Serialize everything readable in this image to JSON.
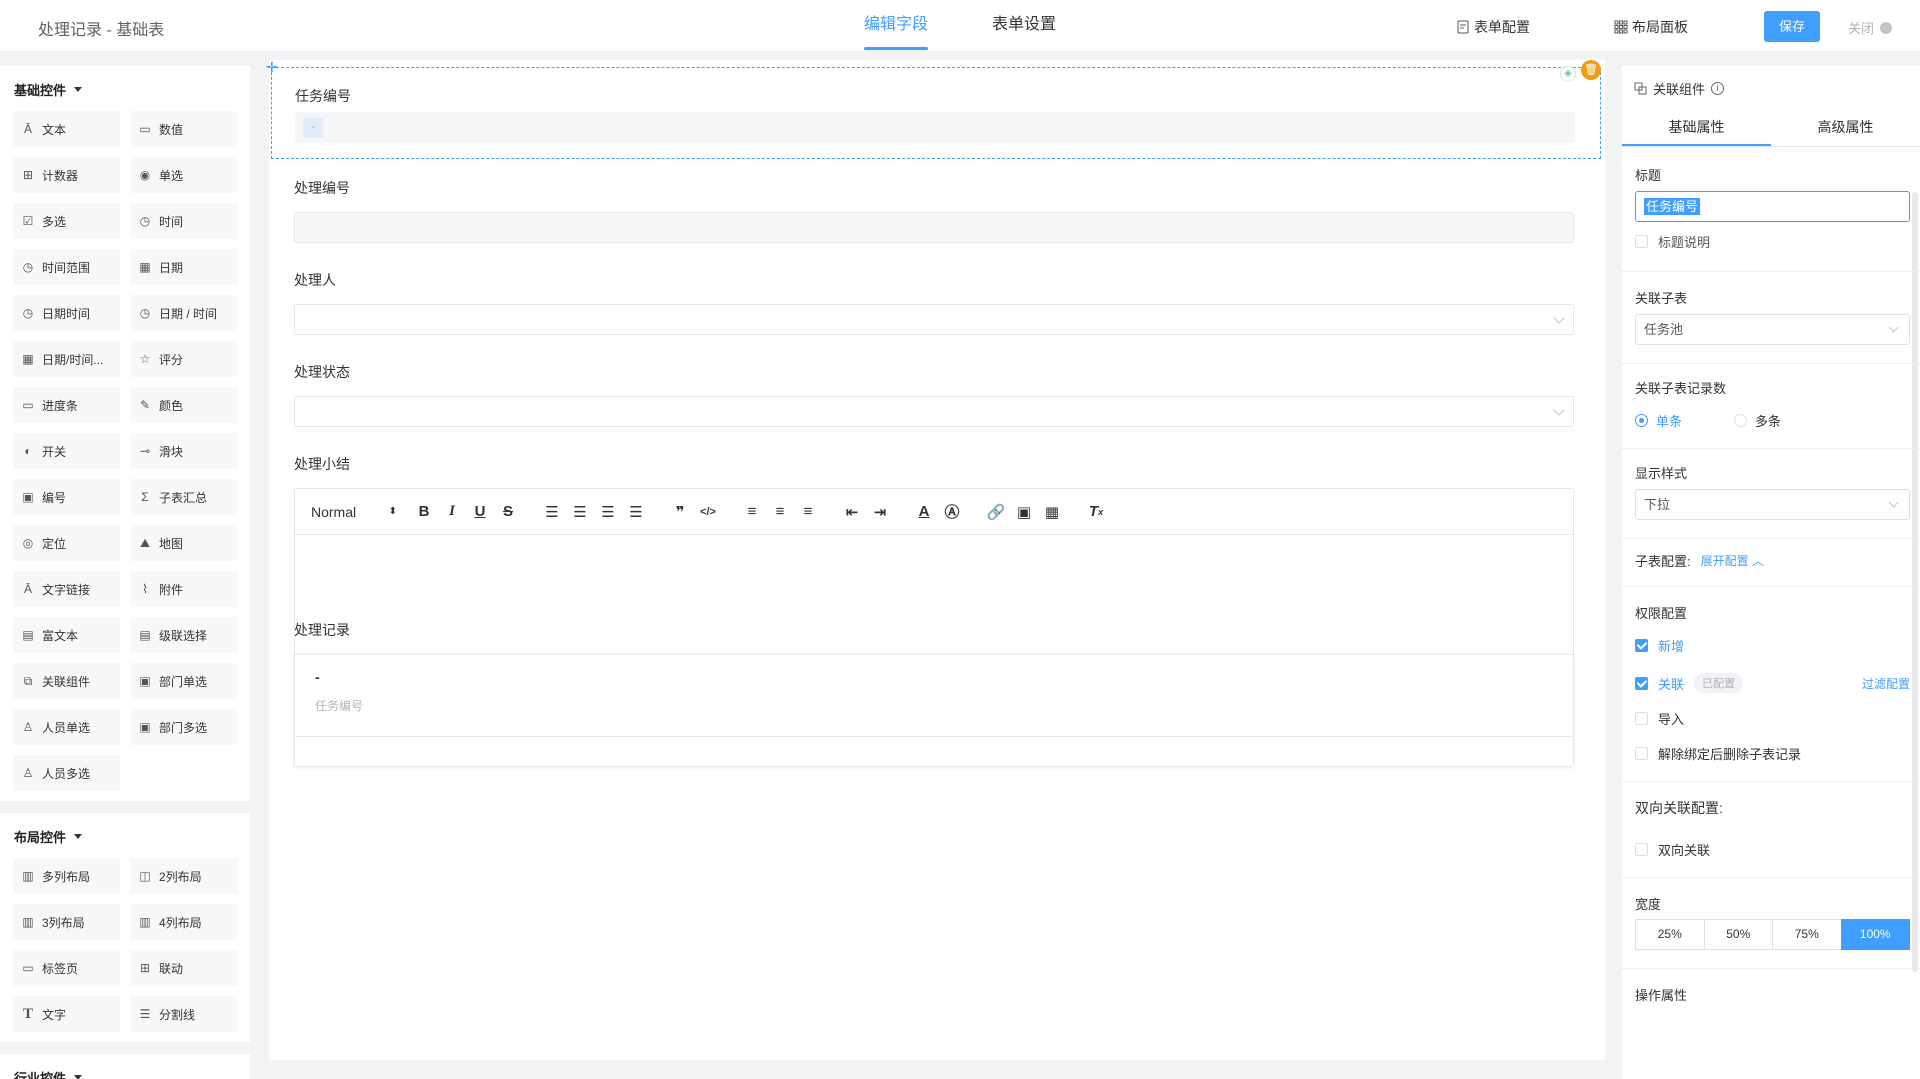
{
  "header": {
    "title": "处理记录 - 基础表",
    "tabs": [
      "编辑字段",
      "表单设置"
    ],
    "form_config": "表单配置",
    "layout_panel": "布局面板",
    "save": "保存",
    "close": "关闭"
  },
  "left": {
    "basic_title": "基础控件",
    "basic_items": [
      {
        "label": "文本",
        "icon": "text-icon"
      },
      {
        "label": "数值",
        "icon": "number-icon"
      },
      {
        "label": "计数器",
        "icon": "counter-icon"
      },
      {
        "label": "单选",
        "icon": "radio-icon"
      },
      {
        "label": "多选",
        "icon": "checkbox-icon"
      },
      {
        "label": "时间",
        "icon": "clock-icon"
      },
      {
        "label": "时间范围",
        "icon": "clock-range-icon"
      },
      {
        "label": "日期",
        "icon": "calendar-icon"
      },
      {
        "label": "日期时间",
        "icon": "datetime-icon"
      },
      {
        "label": "日期 / 时间",
        "icon": "calendar-clock-icon"
      },
      {
        "label": "日期/时间...",
        "icon": "date-range-icon"
      },
      {
        "label": "评分",
        "icon": "star-icon"
      },
      {
        "label": "进度条",
        "icon": "progress-icon"
      },
      {
        "label": "颜色",
        "icon": "color-picker-icon"
      },
      {
        "label": "开关",
        "icon": "toggle-icon"
      },
      {
        "label": "滑块",
        "icon": "slider-icon"
      },
      {
        "label": "编号",
        "icon": "numbering-icon"
      },
      {
        "label": "子表汇总",
        "icon": "sigma-icon"
      },
      {
        "label": "定位",
        "icon": "location-icon"
      },
      {
        "label": "地图",
        "icon": "map-icon"
      },
      {
        "label": "文字链接",
        "icon": "text-link-icon"
      },
      {
        "label": "附件",
        "icon": "paperclip-icon"
      },
      {
        "label": "富文本",
        "icon": "rich-text-icon"
      },
      {
        "label": "级联选择",
        "icon": "cascade-icon"
      },
      {
        "label": "关联组件",
        "icon": "link-component-icon"
      },
      {
        "label": "部门单选",
        "icon": "department-icon"
      },
      {
        "label": "人员单选",
        "icon": "user-icon"
      },
      {
        "label": "部门多选",
        "icon": "departments-icon"
      },
      {
        "label": "人员多选",
        "icon": "users-icon"
      }
    ],
    "layout_title": "布局控件",
    "layout_items": [
      {
        "label": "多列布局",
        "icon": "columns-icon"
      },
      {
        "label": "2列布局",
        "icon": "two-columns-icon"
      },
      {
        "label": "3列布局",
        "icon": "three-columns-icon"
      },
      {
        "label": "4列布局",
        "icon": "four-columns-icon"
      },
      {
        "label": "标签页",
        "icon": "tabs-icon"
      },
      {
        "label": "联动",
        "icon": "linkage-icon"
      },
      {
        "label": "文字",
        "icon": "text-t-icon"
      },
      {
        "label": "分割线",
        "icon": "divider-icon"
      }
    ],
    "industry_title": "行业控件"
  },
  "canvas": {
    "selected_label": "任务编号",
    "selected_value": "-",
    "fields": [
      "处理编号",
      "处理人",
      "处理状态",
      "处理小结",
      "处理记录"
    ],
    "editor_normal": "Normal",
    "record_dash": "-",
    "record_sub": "任务编号"
  },
  "right": {
    "header": "关联组件",
    "tabs": [
      "基础属性",
      "高级属性"
    ],
    "title_label": "标题",
    "title_value": "任务编号",
    "title_desc": "标题说明",
    "subtable_label": "关联子表",
    "subtable_value": "任务池",
    "count_label": "关联子表记录数",
    "count_single": "单条",
    "count_multi": "多条",
    "display_label": "显示样式",
    "display_value": "下拉",
    "subconfig_label": "子表配置:",
    "subconfig_link": "展开配置",
    "perm_label": "权限配置",
    "perm_add": "新增",
    "perm_link": "关联",
    "perm_configured": "已配置",
    "perm_filter": "过滤配置",
    "perm_import": "导入",
    "perm_unbind": "解除绑定后删除子表记录",
    "bi_label": "双向关联配置:",
    "bi_option": "双向关联",
    "width_label": "宽度",
    "widths": [
      "25%",
      "50%",
      "75%",
      "100%"
    ],
    "ops_label": "操作属性"
  },
  "colors": {
    "accent": "#409eff",
    "warning": "#f39c12"
  }
}
